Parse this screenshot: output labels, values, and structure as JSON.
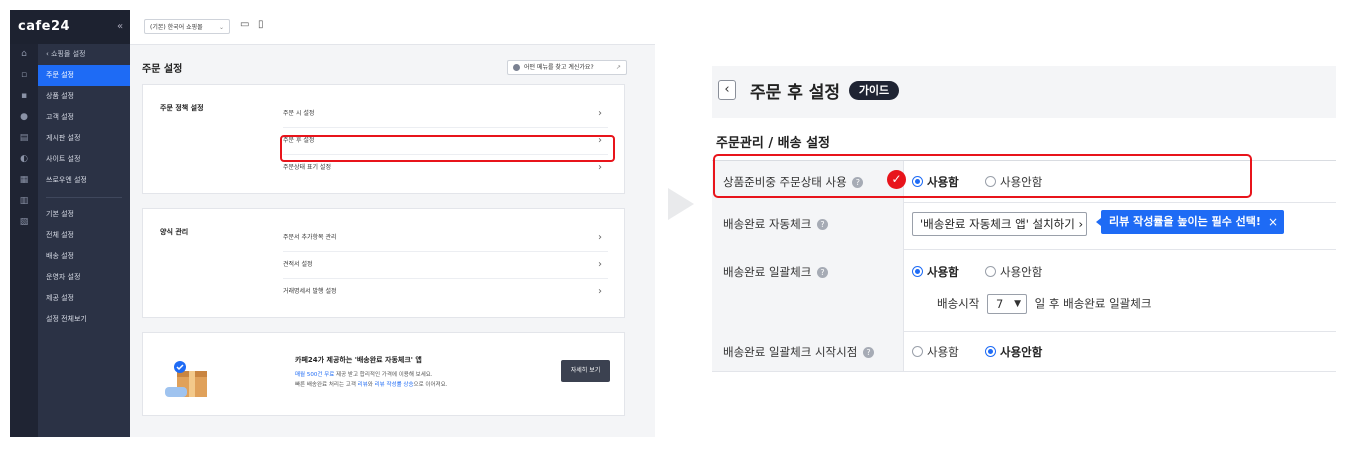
{
  "admin": {
    "logo": "cafe24",
    "collapse": "«",
    "shop_select": "(기본) 한국어 쇼핑몰",
    "menu_back": "‹ 쇼핑몰 설정",
    "menu_group1": [
      "주문 설정",
      "상품 설정",
      "고객 설정",
      "게시판 설정",
      "사이트 설정",
      "쓰로우엔 설정"
    ],
    "menu_group2": [
      "기본 설정",
      "전체 설정",
      "배송 설정",
      "운영자 설정",
      "제공 설정",
      "설정 전체보기"
    ],
    "page_title": "주문 설정",
    "help_button": "어떤 메뉴를 찾고 계신가요?",
    "card1_title": "주문 정책 설정",
    "card1_rows": [
      "주문 시 설정",
      "주문 후 설정",
      "주문상태 표기 설정"
    ],
    "card2_title": "양식 관리",
    "card2_rows": [
      "주문서 추가항목 관리",
      "견적서 설정",
      "거래명세서 발행 설정"
    ],
    "promo_title": "카페24가 제공하는 '배송완료 자동체크' 앱",
    "promo_line1_blue": "매월 500건 무료",
    "promo_line1_rest": " 제공 받고 합리적인 가격에 이용해 보세요.",
    "promo_line2_pre": "빠른 배송완료 처리는 고객 ",
    "promo_line2_blue": "리뷰",
    "promo_line2_mid": "와 ",
    "promo_line2_blue2": "리뷰 작성률 상승",
    "promo_line2_end": "으로 이어져요.",
    "detail_button": "자세히 보기",
    "arrow_char": "›"
  },
  "detail": {
    "back": "‹",
    "title": "주문 후 설정",
    "guide_badge": "가이드",
    "section": "주문관리 / 배송 설정",
    "rows": [
      {
        "label": "상품준비중 주문상태 사용",
        "opt_on": "사용함",
        "opt_off": "사용안함"
      },
      {
        "label": "배송완료 자동체크",
        "app_button": "'배송완료 자동체크 앱' 설치하기 ›",
        "tooltip": "리뷰 작성률을 높이는 필수 선택!",
        "tooltip_close": "×"
      },
      {
        "label": "배송완료 일괄체크",
        "opt_on": "사용함",
        "opt_off": "사용안함",
        "sub_prefix": "배송시작",
        "days": "7",
        "sub_suffix": "일 후 배송완료 일괄체크"
      },
      {
        "label": "배송완료 일괄체크 시작시점",
        "opt_off": "사용함",
        "opt_on": "사용안함"
      }
    ],
    "help_icon": "?",
    "check_mark": "✓"
  },
  "colors": {
    "accent": "#1e6bf5",
    "highlight": "#e8141b",
    "sidebar": "#2b3245"
  }
}
